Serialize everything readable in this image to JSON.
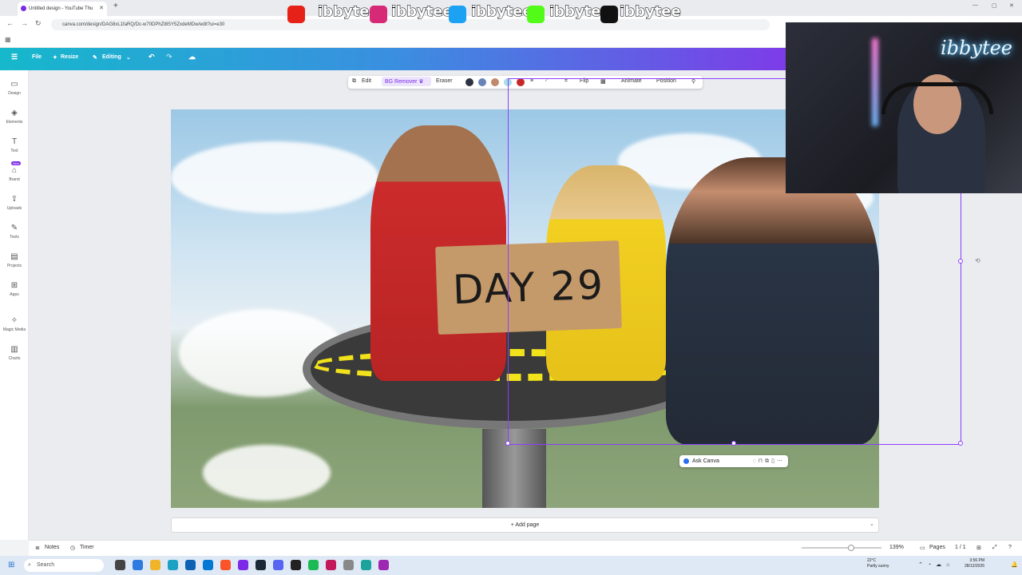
{
  "browser": {
    "tab_title": "Untitled design - YouTube Thu",
    "url": "canva.com/design/DAG8xL1faRQ/Dc-w70DPhZl8SY5ZxdeMDw/edit?ui=e30"
  },
  "canva_header": {
    "file": "File",
    "resize": "Resize",
    "editing": "Editing"
  },
  "sidebar": [
    {
      "label": "Design",
      "icon": "layout-icon"
    },
    {
      "label": "Elements",
      "icon": "shapes-icon"
    },
    {
      "label": "Text",
      "icon": "text-icon"
    },
    {
      "label": "Brand",
      "icon": "brand-icon",
      "badge": "New"
    },
    {
      "label": "Uploads",
      "icon": "upload-icon"
    },
    {
      "label": "Tools",
      "icon": "pencil-icon"
    },
    {
      "label": "Projects",
      "icon": "folder-icon"
    },
    {
      "label": "Apps",
      "icon": "apps-icon"
    },
    {
      "label": "Magic Media",
      "icon": "magic-icon"
    },
    {
      "label": "Charts",
      "icon": "chart-icon"
    }
  ],
  "context_toolbar": {
    "edit": "Edit",
    "bg_remover": "BG Remover",
    "eraser": "Eraser",
    "flip": "Flip",
    "animate": "Animate",
    "position": "Position",
    "swatch_colors": [
      "#2d3142",
      "#6a82b8",
      "#c0896b",
      "#a9dbe8",
      "#c62828"
    ]
  },
  "design": {
    "sign_text": "DAY 29"
  },
  "ask_canva": {
    "label": "Ask Canva"
  },
  "add_page": "+ Add page",
  "bottom_bar": {
    "notes": "Notes",
    "timer": "Timer",
    "zoom": "139%",
    "zoom_level": 0.62,
    "pages_label": "Pages",
    "page_count": "1 / 1"
  },
  "taskbar": {
    "search_placeholder": "Search",
    "temperature": "22°C",
    "weather": "Partly sunny",
    "time": "3:56 PM",
    "date": "28/12/2025"
  },
  "social_overlay": [
    {
      "handle": "ibbytee",
      "icon": "youtube-icon",
      "color": "#e62117"
    },
    {
      "handle": "ibbytee",
      "icon": "instagram-icon",
      "color": "#d62976"
    },
    {
      "handle": "ibbytee_",
      "icon": "twitter-icon",
      "color": "#1da1f2"
    },
    {
      "handle": "ibbytee",
      "icon": "kick-icon",
      "color": "#53fc18"
    },
    {
      "handle": "ibbytee",
      "icon": "tiktok-icon",
      "color": "#111111"
    }
  ],
  "webcam": {
    "neon_sign": "ibbytee"
  }
}
